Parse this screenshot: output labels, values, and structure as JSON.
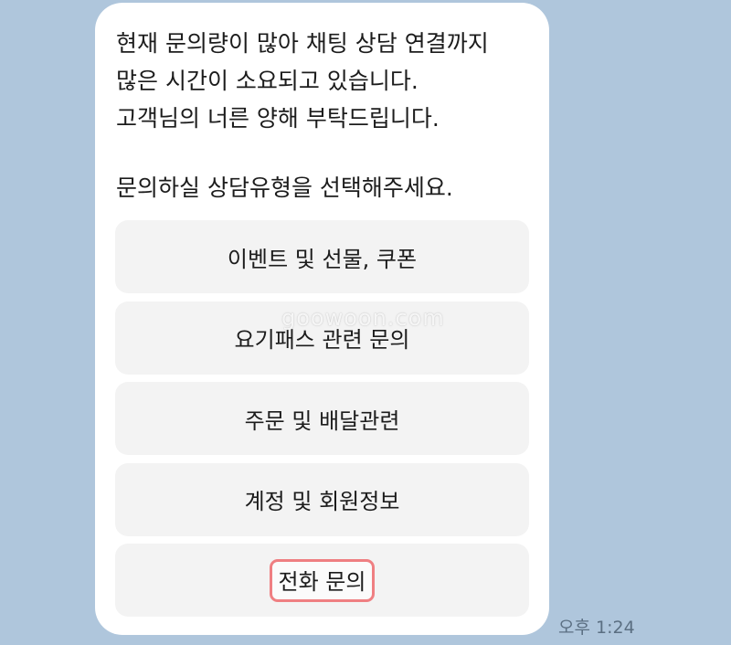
{
  "message": {
    "lines": [
      "현재 문의량이 많아 채팅 상담 연결까지",
      "많은 시간이 소요되고 있습니다.",
      "고객님의 너른 양해 부탁드립니다.",
      "문의하실 상담유형을 선택해주세요."
    ]
  },
  "options": [
    {
      "label": "이벤트 및 선물, 쿠폰"
    },
    {
      "label": "요기패스 관련 문의"
    },
    {
      "label": "주문 및 배달관련"
    },
    {
      "label": "계정 및 회원정보"
    },
    {
      "label": "전화 문의"
    }
  ],
  "watermark": "goowoon.com",
  "timestamp": "오후 1:24",
  "colors": {
    "background": "#afc6dc",
    "bubble": "#ffffff",
    "option_bg": "#f3f3f3",
    "highlight_border": "#ef7f82"
  }
}
